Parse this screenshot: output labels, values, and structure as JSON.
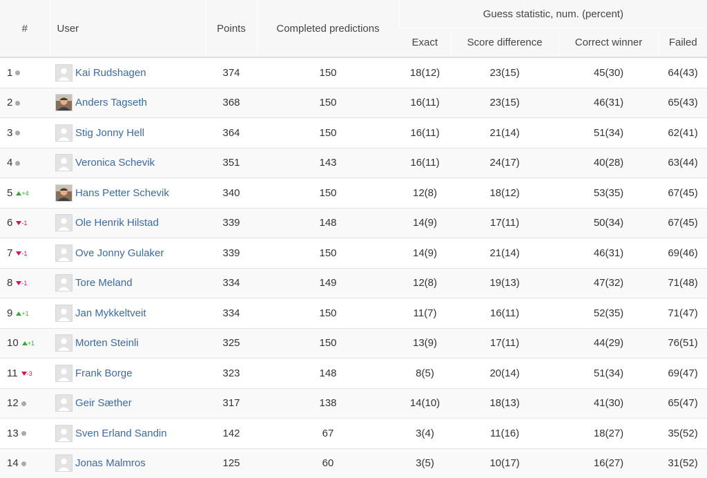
{
  "headers": {
    "rank": "#",
    "user": "User",
    "points": "Points",
    "completed": "Completed predictions",
    "guess_group": "Guess statistic, num. (percent)",
    "exact": "Exact",
    "score_diff": "Score difference",
    "correct_winner": "Correct winner",
    "failed": "Failed"
  },
  "colors": {
    "link": "#3b6aa8",
    "up": "#33aa33",
    "down": "#d6124f",
    "neutral": "#aaaaaa"
  },
  "rows": [
    {
      "rank": "1",
      "trend": "same",
      "change": "",
      "avatar": "placeholder",
      "name": "Kai Rudshagen",
      "points": "374",
      "completed": "150",
      "exact": "18(12)",
      "score_diff": "23(15)",
      "correct_winner": "45(30)",
      "failed": "64(43)"
    },
    {
      "rank": "2",
      "trend": "same",
      "change": "",
      "avatar": "photo",
      "name": "Anders Tagseth",
      "points": "368",
      "completed": "150",
      "exact": "16(11)",
      "score_diff": "23(15)",
      "correct_winner": "46(31)",
      "failed": "65(43)"
    },
    {
      "rank": "3",
      "trend": "same",
      "change": "",
      "avatar": "placeholder",
      "name": "Stig Jonny Hell",
      "points": "364",
      "completed": "150",
      "exact": "16(11)",
      "score_diff": "21(14)",
      "correct_winner": "51(34)",
      "failed": "62(41)"
    },
    {
      "rank": "4",
      "trend": "same",
      "change": "",
      "avatar": "placeholder",
      "name": "Veronica Schevik",
      "points": "351",
      "completed": "143",
      "exact": "16(11)",
      "score_diff": "24(17)",
      "correct_winner": "40(28)",
      "failed": "63(44)"
    },
    {
      "rank": "5",
      "trend": "up",
      "change": "+4",
      "avatar": "photo",
      "name": "Hans Petter Schevik",
      "points": "340",
      "completed": "150",
      "exact": "12(8)",
      "score_diff": "18(12)",
      "correct_winner": "53(35)",
      "failed": "67(45)"
    },
    {
      "rank": "6",
      "trend": "down",
      "change": "-1",
      "avatar": "placeholder",
      "name": "Ole Henrik Hilstad",
      "points": "339",
      "completed": "148",
      "exact": "14(9)",
      "score_diff": "17(11)",
      "correct_winner": "50(34)",
      "failed": "67(45)"
    },
    {
      "rank": "7",
      "trend": "down",
      "change": "-1",
      "avatar": "placeholder",
      "name": "Ove Jonny Gulaker",
      "points": "339",
      "completed": "150",
      "exact": "14(9)",
      "score_diff": "21(14)",
      "correct_winner": "46(31)",
      "failed": "69(46)"
    },
    {
      "rank": "8",
      "trend": "down",
      "change": "-1",
      "avatar": "placeholder",
      "name": "Tore Meland",
      "points": "334",
      "completed": "149",
      "exact": "12(8)",
      "score_diff": "19(13)",
      "correct_winner": "47(32)",
      "failed": "71(48)"
    },
    {
      "rank": "9",
      "trend": "up",
      "change": "+1",
      "avatar": "placeholder",
      "name": "Jan Mykkeltveit",
      "points": "334",
      "completed": "150",
      "exact": "11(7)",
      "score_diff": "16(11)",
      "correct_winner": "52(35)",
      "failed": "71(47)"
    },
    {
      "rank": "10",
      "trend": "up",
      "change": "+1",
      "avatar": "placeholder",
      "name": "Morten Steinli",
      "points": "325",
      "completed": "150",
      "exact": "13(9)",
      "score_diff": "17(11)",
      "correct_winner": "44(29)",
      "failed": "76(51)"
    },
    {
      "rank": "11",
      "trend": "down",
      "change": "-3",
      "avatar": "placeholder",
      "name": "Frank Borge",
      "points": "323",
      "completed": "148",
      "exact": "8(5)",
      "score_diff": "20(14)",
      "correct_winner": "51(34)",
      "failed": "69(47)"
    },
    {
      "rank": "12",
      "trend": "same",
      "change": "",
      "avatar": "placeholder",
      "name": "Geir Sæther",
      "points": "317",
      "completed": "138",
      "exact": "14(10)",
      "score_diff": "18(13)",
      "correct_winner": "41(30)",
      "failed": "65(47)"
    },
    {
      "rank": "13",
      "trend": "same",
      "change": "",
      "avatar": "placeholder",
      "name": "Sven Erland Sandin",
      "points": "142",
      "completed": "67",
      "exact": "3(4)",
      "score_diff": "11(16)",
      "correct_winner": "18(27)",
      "failed": "35(52)"
    },
    {
      "rank": "14",
      "trend": "same",
      "change": "",
      "avatar": "placeholder",
      "name": "Jonas Malmros",
      "points": "125",
      "completed": "60",
      "exact": "3(5)",
      "score_diff": "10(17)",
      "correct_winner": "16(27)",
      "failed": "31(52)"
    }
  ]
}
